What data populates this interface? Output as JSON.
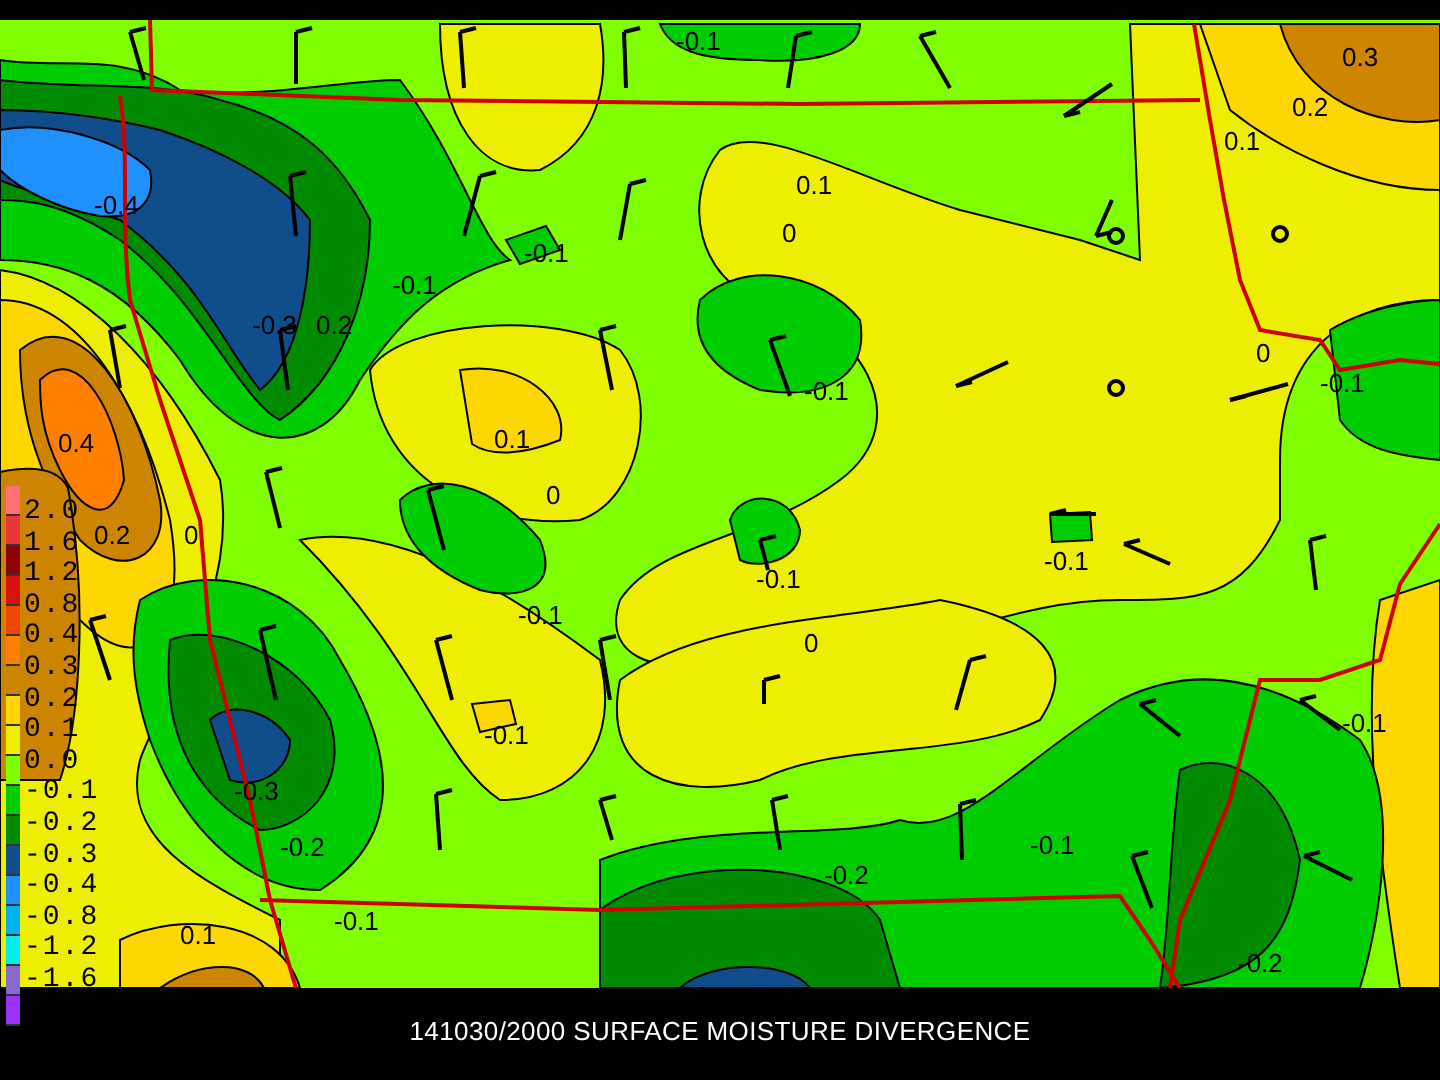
{
  "map": {
    "contour_labels": [
      "-0.1",
      "0.3",
      "0.2",
      "0.1",
      "-0.4",
      "0.1",
      "0",
      "-0.1",
      "-0.1",
      "-0.3",
      "0.2",
      "0",
      "-0.1",
      "-0.1",
      "0.4",
      "0.1",
      "0.2",
      "0",
      "0",
      "-0.1",
      "-0.1",
      "-0.1",
      "0",
      "-0.1",
      "-0.1",
      "-0.3",
      "-0.2",
      "-0.1",
      "-0.2",
      "-0.1",
      "0.1",
      "-0.2"
    ]
  },
  "legend": {
    "swatches": [
      {
        "color": "#ff7070"
      },
      {
        "color": "#e83838"
      },
      {
        "color": "#8b0000"
      },
      {
        "color": "#d81010"
      },
      {
        "color": "#f04800"
      },
      {
        "color": "#ff8000"
      },
      {
        "color": "#cd8500"
      },
      {
        "color": "#ffd700"
      },
      {
        "color": "#eeee00"
      },
      {
        "color": "#80ff00"
      },
      {
        "color": "#00cd00"
      },
      {
        "color": "#008b00"
      },
      {
        "color": "#104e8b"
      },
      {
        "color": "#1e90ff"
      },
      {
        "color": "#00b2ee"
      },
      {
        "color": "#00eeee"
      },
      {
        "color": "#8968cd"
      },
      {
        "color": "#9b30ff"
      }
    ],
    "labels": [
      "2.0",
      "1.6",
      "1.2",
      "0.8",
      "0.4",
      "0.3",
      "0.2",
      "0.1",
      "0.0",
      "-0.1",
      "-0.2",
      "-0.3",
      "-0.4",
      "-0.8",
      "-1.2",
      "-1.6"
    ]
  },
  "title": "141030/2000 SURFACE MOISTURE DIVERGENCE"
}
